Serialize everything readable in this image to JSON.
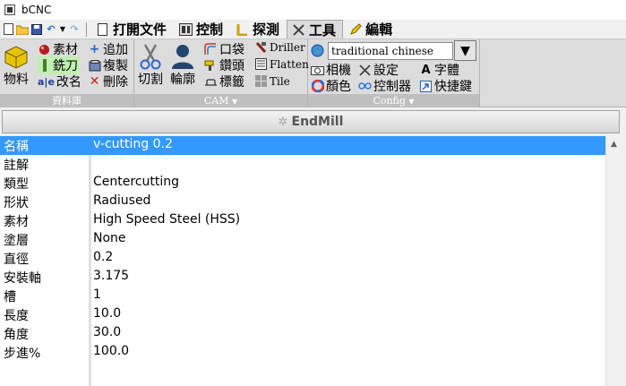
{
  "window": {
    "title": "bCNC"
  },
  "tabs": [
    {
      "label": "打開文件",
      "icon": "file-icon"
    },
    {
      "label": "控制",
      "icon": "control-panel-icon"
    },
    {
      "label": "探測",
      "icon": "probe-icon"
    },
    {
      "label": "工具",
      "icon": "tools-icon",
      "active": true
    },
    {
      "label": "編輯",
      "icon": "pencil-icon"
    }
  ],
  "ribbon": {
    "library": {
      "label": "資料庫",
      "material": "物料",
      "stock": "素材",
      "endmill": "銑刀",
      "rename": "改名",
      "add": "追加",
      "copy": "複製",
      "delete": "刪除"
    },
    "cam": {
      "label": "CAM",
      "cut": "切割",
      "profile": "輪廓",
      "pocket": "口袋",
      "drill": "鑽頭",
      "tabs": "標籤",
      "driller": "Driller",
      "flatten": "Flatten",
      "tile": "Tile"
    },
    "config": {
      "label": "Config",
      "language": "traditional chinese",
      "camera": "相機",
      "settings": "設定",
      "font": "字體",
      "color": "顏色",
      "controller": "控制器",
      "shortcuts": "快捷鍵"
    }
  },
  "panel": {
    "header": "EndMill",
    "rows": [
      {
        "key": "名稱",
        "value": "v-cutting 0.2",
        "selected": true
      },
      {
        "key": "註解",
        "value": ""
      },
      {
        "key": "類型",
        "value": "Centercutting"
      },
      {
        "key": "形狀",
        "value": "Radiused"
      },
      {
        "key": "素材",
        "value": "High Speed Steel (HSS)"
      },
      {
        "key": "塗層",
        "value": "None"
      },
      {
        "key": "直徑",
        "value": "0.2"
      },
      {
        "key": "安裝軸",
        "value": "3.175"
      },
      {
        "key": "槽",
        "value": "1"
      },
      {
        "key": "長度",
        "value": "10.0"
      },
      {
        "key": "角度",
        "value": "30.0"
      },
      {
        "key": "步進%",
        "value": "100.0"
      }
    ]
  },
  "colors": {
    "selection": "#3399ff",
    "ribbon_bg": "#dcdcdc",
    "group_label_bg": "#bfbfbf"
  }
}
